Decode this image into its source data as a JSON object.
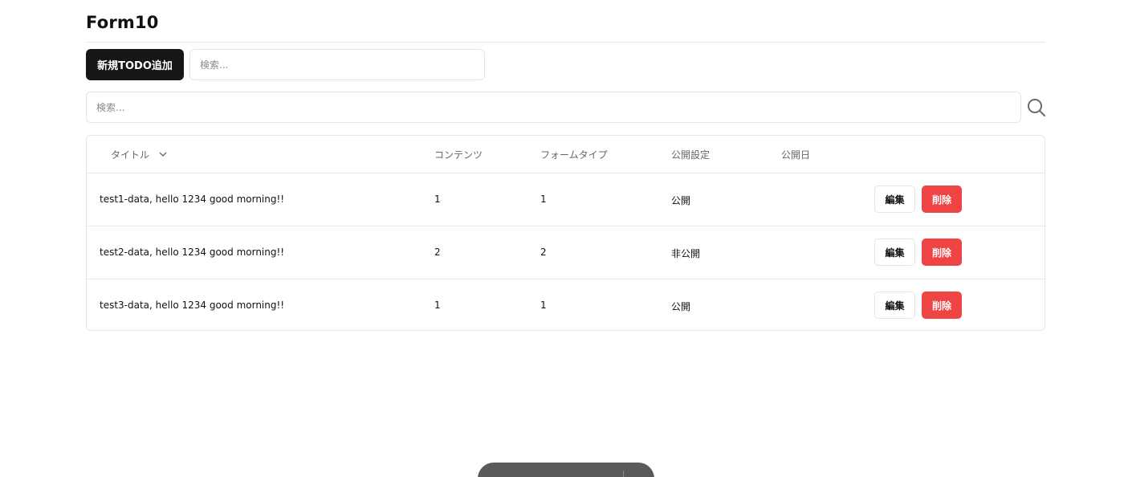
{
  "header": {
    "title": "Form10"
  },
  "toolbar": {
    "add_label": "新規TODO追加",
    "search_placeholder": "検索..."
  },
  "search_bar": {
    "placeholder": "検索...",
    "icon": "search-icon"
  },
  "table": {
    "columns": [
      "タイトル",
      "コンテンツ",
      "フォームタイプ",
      "公開設定",
      "公開日"
    ],
    "sort_icon": "chevron-down-icon",
    "rows": [
      {
        "title": "test1-data, hello 1234 good morning!!",
        "content": "1",
        "form_type": "1",
        "visibility": "公開",
        "date": "",
        "edit_label": "編集",
        "delete_label": "削除"
      },
      {
        "title": "test2-data, hello 1234 good morning!!",
        "content": "2",
        "form_type": "2",
        "visibility": "非公開",
        "date": "",
        "edit_label": "編集",
        "delete_label": "削除"
      },
      {
        "title": "test3-data, hello 1234 good morning!!",
        "content": "1",
        "form_type": "1",
        "visibility": "公開",
        "date": "",
        "edit_label": "編集",
        "delete_label": "削除"
      }
    ]
  },
  "colors": {
    "primary_button": "#161616",
    "danger_button": "#ef4444",
    "border": "#e6e6e6",
    "floating_bar": "#5a5a5a"
  }
}
